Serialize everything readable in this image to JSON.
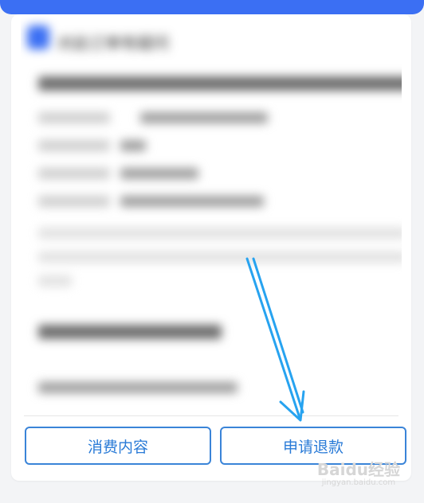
{
  "colors": {
    "accent": "#3b6ff3",
    "button_border": "#3a84d8",
    "button_text": "#2a7bd7",
    "arrow": "#27a3f0"
  },
  "card": {
    "header_icon": "blue-square-icon",
    "header_text": "对此订单有疑问"
  },
  "actions": {
    "consume_label": "消费内容",
    "refund_label": "申请退款"
  },
  "watermark": {
    "main": "Baidu经验",
    "sub": "jingyan.baidu.com"
  }
}
